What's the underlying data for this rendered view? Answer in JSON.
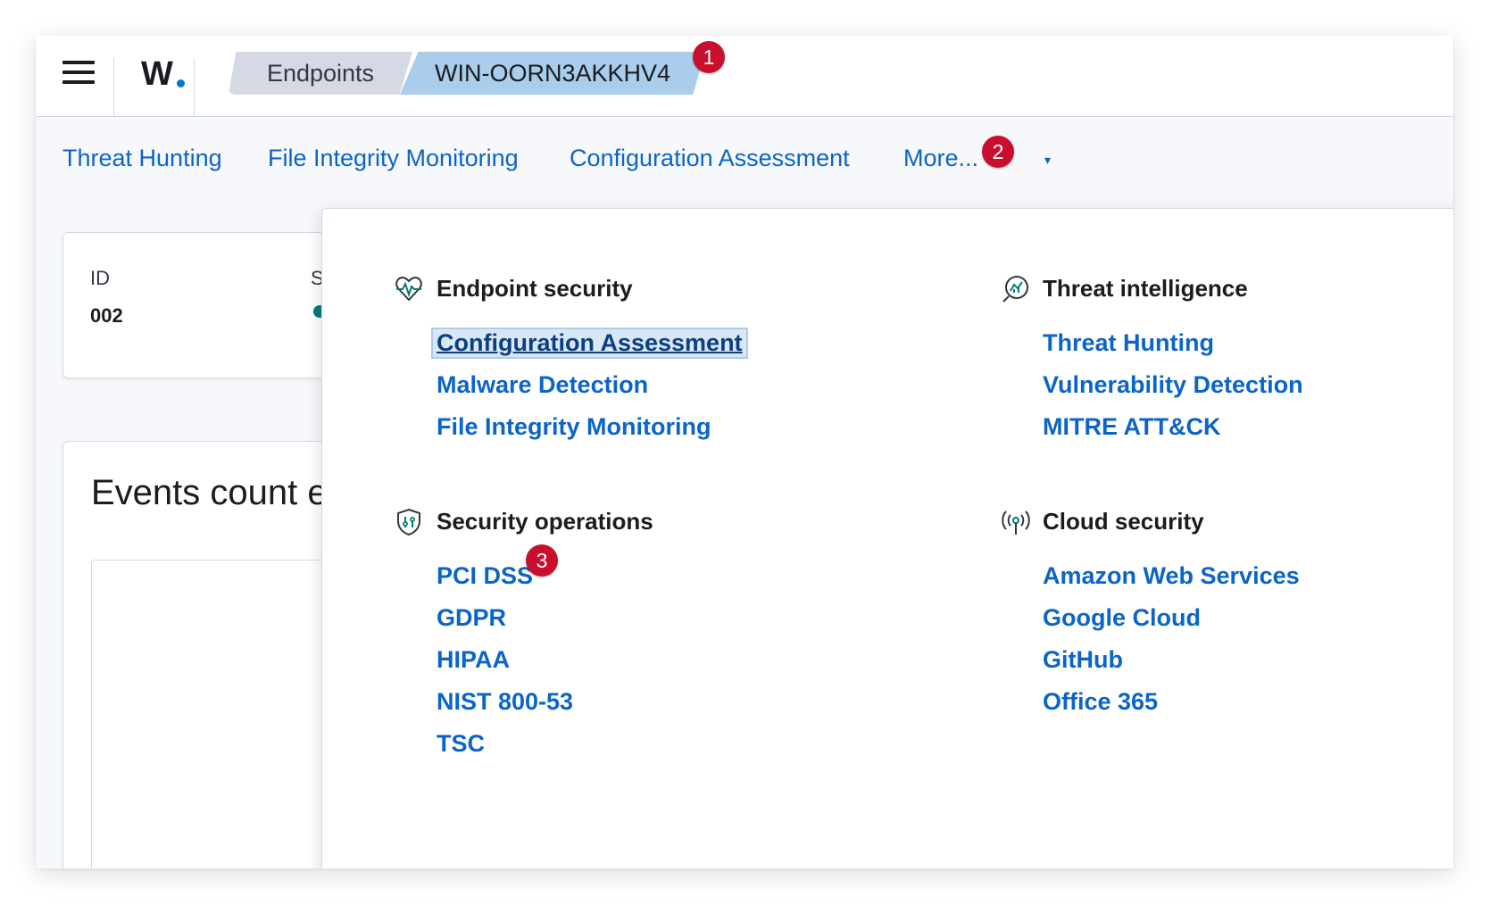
{
  "header": {
    "logo_text": "W",
    "breadcrumbs": [
      "Endpoints",
      "WIN-OORN3AKKHV4"
    ]
  },
  "tabs": [
    "Threat Hunting",
    "File Integrity Monitoring",
    "Configuration Assessment",
    "More..."
  ],
  "agent_card": {
    "id_label": "ID",
    "id_value": "002",
    "status_label_partial": "S"
  },
  "events_title_partial": "Events count ev",
  "badges": [
    "1",
    "2",
    "3"
  ],
  "menu": {
    "endpoint_security": {
      "title": "Endpoint security",
      "icon": "heartbeat-icon",
      "items": [
        "Configuration Assessment",
        "Malware Detection",
        "File Integrity Monitoring"
      ]
    },
    "threat_intelligence": {
      "title": "Threat intelligence",
      "icon": "radar-chart-icon",
      "items": [
        "Threat Hunting",
        "Vulnerability Detection",
        "MITRE ATT&CK"
      ]
    },
    "security_operations": {
      "title": "Security operations",
      "icon": "shield-sliders-icon",
      "items": [
        "PCI DSS",
        "GDPR",
        "HIPAA",
        "NIST 800-53",
        "TSC"
      ]
    },
    "cloud_security": {
      "title": "Cloud security",
      "icon": "broadcast-icon",
      "items": [
        "Amazon Web Services",
        "Google Cloud",
        "GitHub",
        "Office 365"
      ]
    }
  },
  "colors": {
    "link": "#0b64c8",
    "badge": "#c8102e",
    "active_crumb": "#a9cdea",
    "crumb": "#d4d9e3",
    "status_online": "#017d73"
  }
}
